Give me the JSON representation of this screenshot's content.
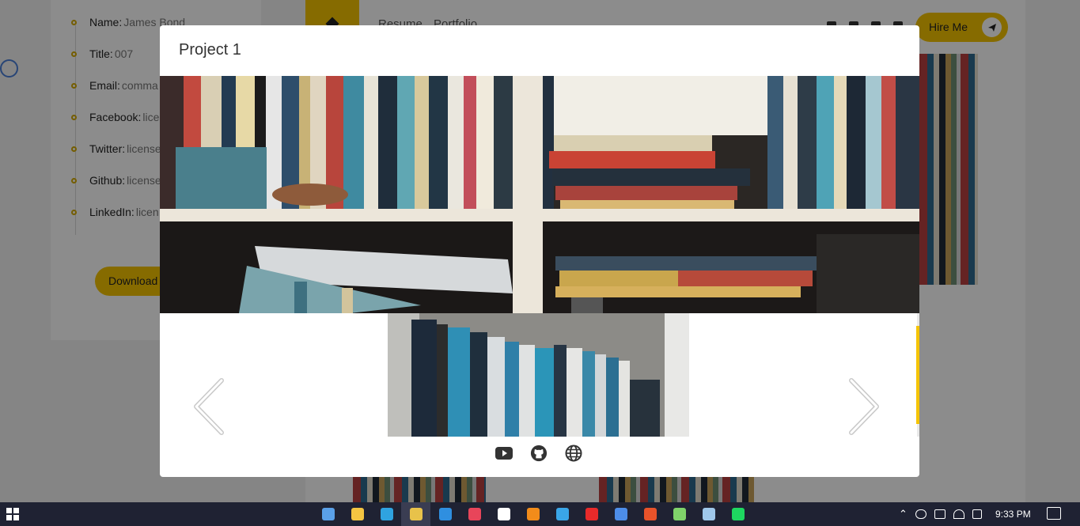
{
  "profile": {
    "items": [
      {
        "label": "Name:",
        "value": "James Bond"
      },
      {
        "label": "Title:",
        "value": "007"
      },
      {
        "label": "Email:",
        "value": "comma"
      },
      {
        "label": "Facebook:",
        "value": "lice"
      },
      {
        "label": "Twitter:",
        "value": "license"
      },
      {
        "label": "Github:",
        "value": "license"
      },
      {
        "label": "LinkedIn:",
        "value": "licen"
      }
    ],
    "download_label": "Download"
  },
  "header": {
    "nav": [
      "Resume",
      "Portfolio"
    ],
    "hire_label": "Hire Me"
  },
  "modal": {
    "title": "Project 1",
    "links": [
      {
        "icon": "youtube-icon"
      },
      {
        "icon": "github-icon"
      },
      {
        "icon": "globe-icon"
      }
    ]
  },
  "taskbar": {
    "apps": [
      {
        "icon": "photos-app-icon",
        "color": "#5aa0e8"
      },
      {
        "icon": "file-explorer-icon",
        "color": "#f4c542"
      },
      {
        "icon": "edge-icon",
        "color": "#2fa3e0"
      },
      {
        "icon": "chrome-icon",
        "color": "#e8c24a",
        "active": true
      },
      {
        "icon": "vscode-icon",
        "color": "#2f8fe0"
      },
      {
        "icon": "media-player-icon",
        "color": "#e8455a"
      },
      {
        "icon": "intellij-icon",
        "color": "#ffffff"
      },
      {
        "icon": "vlc-icon",
        "color": "#f28c1a"
      },
      {
        "icon": "docker-icon",
        "color": "#3aa6e8"
      },
      {
        "icon": "record-icon",
        "color": "#e82a2a"
      },
      {
        "icon": "teams-icon",
        "color": "#4d8de8"
      },
      {
        "icon": "office-icon",
        "color": "#e8532a"
      },
      {
        "icon": "terminal-icon",
        "color": "#7fd36a"
      },
      {
        "icon": "virtualbox-icon",
        "color": "#9fc7ea"
      },
      {
        "icon": "spotify-icon",
        "color": "#1ed760"
      }
    ],
    "time": "9:33 PM"
  }
}
